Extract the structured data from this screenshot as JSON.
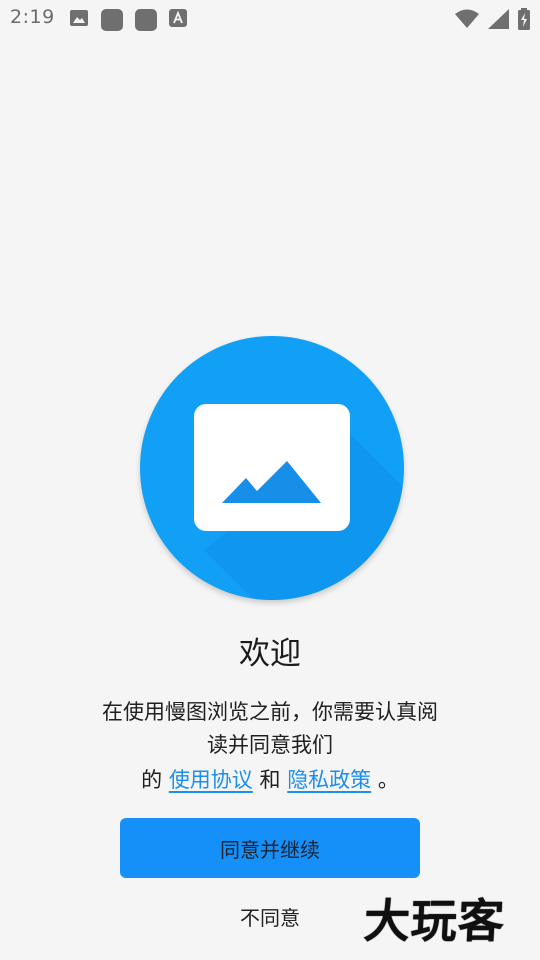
{
  "status_bar": {
    "time": "2:19",
    "left_icons": [
      "image-icon",
      "app-icon",
      "app-icon",
      "text-icon"
    ],
    "right_icons": [
      "wifi-icon",
      "cellular-icon",
      "battery-icon"
    ]
  },
  "hero": {
    "icon": "image-placeholder-icon",
    "colors": {
      "circle": "#12a0f7",
      "mountain": "#178ee7",
      "card": "#ffffff"
    }
  },
  "welcome": {
    "title": "欢迎",
    "line1": "在使用慢图浏览之前，你需要认真阅",
    "line2": "读并同意我们",
    "line3_prefix": "的",
    "terms_link": "使用协议",
    "and": "和",
    "privacy_link": "隐私政策",
    "line3_suffix": "。"
  },
  "actions": {
    "agree_label": "同意并继续",
    "disagree_label": "不同意"
  },
  "watermark": {
    "text": "大玩客"
  }
}
